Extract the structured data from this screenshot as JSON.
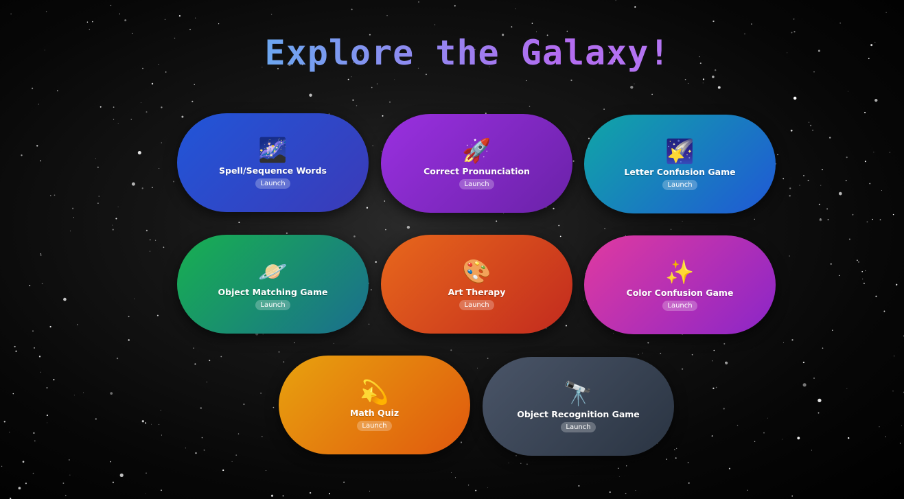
{
  "page": {
    "title": "Explore the Galaxy!"
  },
  "colors": {
    "background": "#000000",
    "title_gradient_start": "#33d6f0",
    "title_gradient_end": "#b48cf5"
  },
  "cards": [
    {
      "label": "Spell/Sequence Words",
      "icon": "milky-way-icon",
      "glyph": "🌌",
      "button": "Launch",
      "color": "#2156d8"
    },
    {
      "label": "Correct Pronunciation",
      "icon": "rocket-icon",
      "glyph": "🚀",
      "button": "Launch",
      "color": "#9a30e0"
    },
    {
      "label": "Letter Confusion Game",
      "icon": "shooting-star-icon",
      "glyph": "🌠",
      "button": "Launch",
      "color": "#10a6a6"
    },
    {
      "label": "Object Matching Game",
      "icon": "ringed-planet-icon",
      "glyph": "🪐",
      "button": "Launch",
      "color": "#18b050"
    },
    {
      "label": "Art Therapy",
      "icon": "palette-icon",
      "glyph": "🎨",
      "button": "Launch",
      "color": "#e8681c"
    },
    {
      "label": "Color Confusion Game",
      "icon": "sparkles-icon",
      "glyph": "✨",
      "button": "Launch",
      "color": "#e03aa0"
    },
    {
      "label": "Math Quiz",
      "icon": "dizzy-star-icon",
      "glyph": "💫",
      "button": "Launch",
      "color": "#e8a20e"
    },
    {
      "label": "Object Recognition Game",
      "icon": "telescope-icon",
      "glyph": "🔭",
      "button": "Launch",
      "color": "#4a5568"
    }
  ]
}
